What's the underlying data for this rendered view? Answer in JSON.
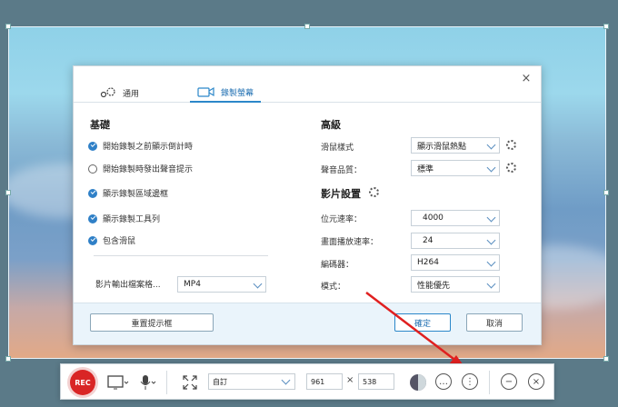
{
  "dialog": {
    "tabs": [
      {
        "label": "通用",
        "icon": "gear-icon"
      },
      {
        "label": "錄製螢幕",
        "icon": "video-camera-icon"
      }
    ],
    "left": {
      "heading": "基礎",
      "checks": [
        {
          "label": "開始錄製之前顯示倒計時",
          "checked": true
        },
        {
          "label": "開始錄製時發出聲音提示",
          "checked": false
        },
        {
          "label": "顯示錄製區域邊框",
          "checked": true
        },
        {
          "label": "顯示錄製工具列",
          "checked": true
        },
        {
          "label": "包含滑鼠",
          "checked": true
        }
      ],
      "format_label": "影片輸出檔案格...",
      "format_value": "MP4"
    },
    "right": {
      "heading": "高級",
      "mouse_label": "滑鼠樣式",
      "mouse_value": "顯示滑鼠熱點",
      "audio_label": "聲音品質：",
      "audio_value": "標準",
      "video_heading": "影片設置",
      "bitrate_label": "位元速率：",
      "bitrate_value": "4000",
      "fps_label": "畫面播放速率：",
      "fps_value": "24",
      "encoder_label": "編碼器：",
      "encoder_value": "H264",
      "mode_label": "模式：",
      "mode_value": "性能優先"
    },
    "footer": {
      "reset": "重置提示框",
      "ok": "確定",
      "cancel": "取消"
    },
    "close": "×"
  },
  "toolbar": {
    "rec": "REC",
    "preset": "自訂",
    "width": "961",
    "times": "×",
    "height": "538"
  },
  "colors": {
    "accent": "#2b87c9",
    "rec": "#d92525",
    "arrow": "#e02020"
  }
}
